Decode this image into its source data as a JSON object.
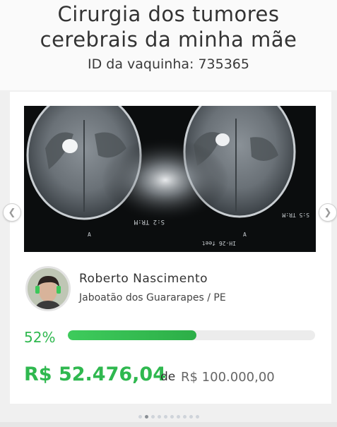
{
  "header": {
    "title_line1": "Cirurgia dos tumores",
    "title_line2": "cerebrais da minha mãe",
    "vaquinha_id": "ID da vaquinha: 735365"
  },
  "owner": {
    "name": "Roberto Nascimento",
    "location": "Jaboatão dos Guararapes / PE"
  },
  "progress": {
    "percent_label": "52%",
    "fraction": 0.52
  },
  "amounts": {
    "raised": "R$ 52.476,04",
    "connector": "de",
    "goal": "R$ 100.000,00"
  },
  "carousel": {
    "dot_count": 10,
    "active_index": 1
  },
  "colors": {
    "accent_green": "#2fb84f",
    "text_dark": "#333333",
    "text_muted": "#666666",
    "track": "#ececec"
  },
  "icons": {
    "prev": "chevron-left-icon",
    "next": "chevron-right-icon"
  }
}
